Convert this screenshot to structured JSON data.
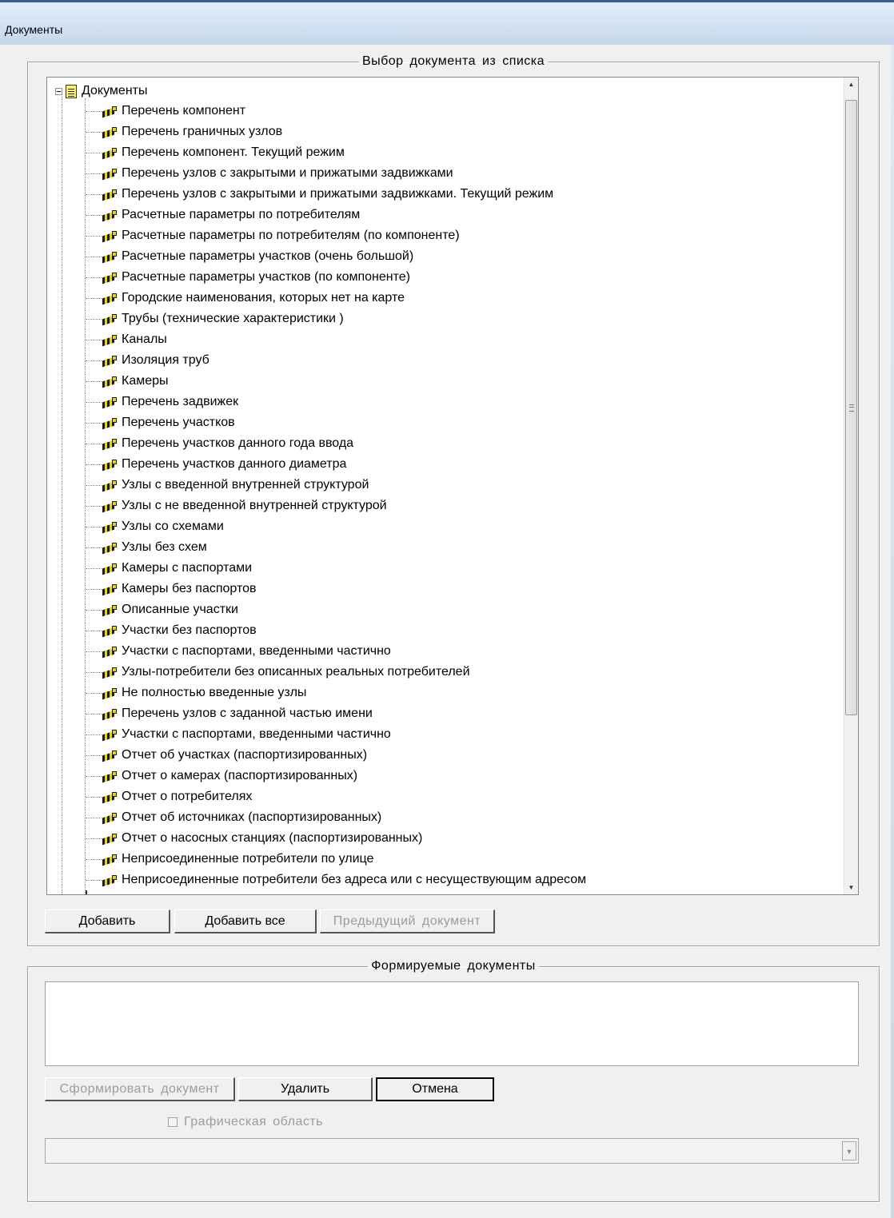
{
  "window": {
    "title": "Документы"
  },
  "selection_group": {
    "legend": "Выбор документа из списка",
    "tree": {
      "root_label": "Документы",
      "items": [
        "Перечень компонент",
        "Перечень граничных узлов",
        "Перечень компонент. Текущий режим",
        "Перечень узлов с закрытыми и прижатыми задвижками",
        "Перечень узлов с закрытыми и прижатыми задвижками. Текущий режим",
        "Расчетные параметры по потребителям",
        "Расчетные параметры по потребителям (по компоненте)",
        "Расчетные параметры участков (очень большой)",
        "Расчетные параметры участков (по компоненте)",
        "Городские наименования, которых нет на карте",
        "Трубы (технические характеристики )",
        "Каналы",
        "Изоляция труб",
        "Камеры",
        "Перечень задвижек",
        "Перечень участков",
        "Перечень участков данного года ввода",
        "Перечень участков данного диаметра",
        "Узлы с введенной внутренней структурой",
        "Узлы с не введенной внутренней структурой",
        "Узлы со схемами",
        "Узлы без схем",
        "Камеры с паспортами",
        "Камеры без паспортов",
        "Описанные участки",
        "Участки без паспортов",
        "Участки с паспортами, введенными частично",
        "Узлы-потребители без описанных реальных потребителей",
        "Не полностью введенные узлы",
        "Перечень узлов с заданной частью имени",
        "Участки с паспортами, введенными частично",
        "Отчет об участках (паспортизированных)",
        "Отчет о камерах (паспортизированных)",
        "Отчет о потребителях",
        "Отчет об источниках (паспортизированных)",
        "Отчет о насосных станциях (паспортизированных)",
        "Неприсоединенные потребители по улице",
        "Неприсоединенные потребители без адреса или с несуществующим адресом"
      ]
    },
    "buttons": {
      "add": "Добавить",
      "add_all": "Добавить все",
      "previous": "Предыдущий документ"
    }
  },
  "formed_group": {
    "legend": "Формируемые документы",
    "items": [],
    "buttons": {
      "form": "Сформировать документ",
      "delete": "Удалить",
      "cancel": "Отмена"
    },
    "graphic_area_checkbox": {
      "label": "Графическая область",
      "checked": false,
      "enabled": false
    },
    "combo_value": ""
  },
  "icons": {
    "root": "document-icon",
    "item": "report-icon",
    "expander": "collapse-minus-icon"
  },
  "colors": {
    "window_bg": "#f0f0f0",
    "titlebar": "#d5e3f3",
    "disabled_text": "#9c9c9c"
  }
}
